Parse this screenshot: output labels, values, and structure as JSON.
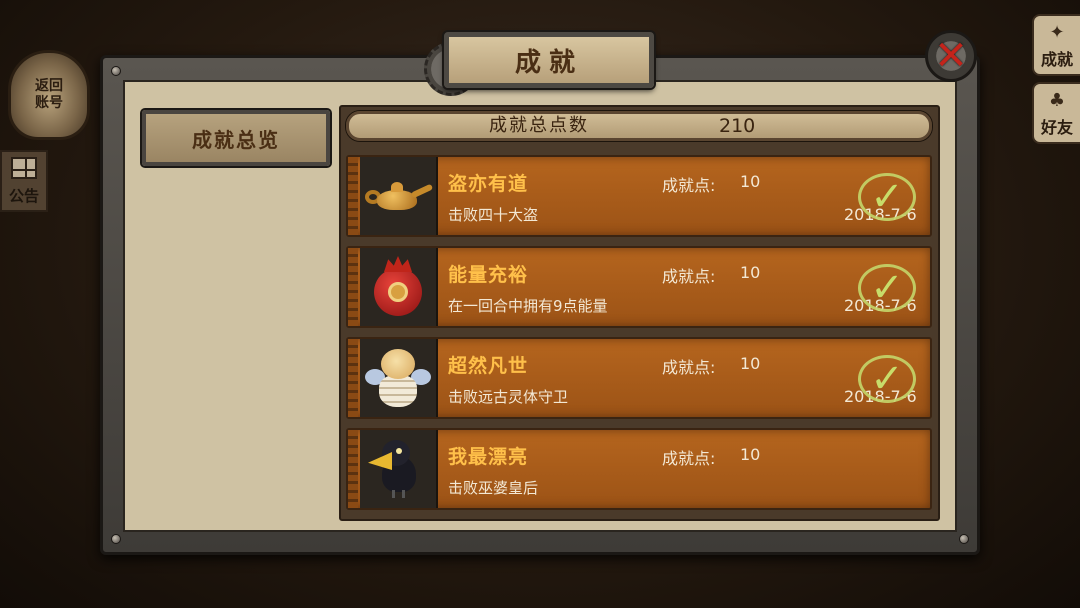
{
  "background": {
    "return_account_label": "返回账号",
    "notice_label": "公告",
    "side_tabs": [
      {
        "label": "成就",
        "icon": "achievement-icon"
      },
      {
        "label": "好友",
        "icon": "friends-icon"
      }
    ]
  },
  "dialog": {
    "title": "成就",
    "close_icon": "close-x-icon",
    "nav": {
      "overview_label": "成就总览"
    },
    "total": {
      "label": "成就总点数",
      "value": "210"
    },
    "points_label": "成就点:",
    "achievements": [
      {
        "name": "盗亦有道",
        "desc": "击败四十大盗",
        "points": "10",
        "date": "2018-7-6",
        "completed": true,
        "icon": "magic-lamp-icon"
      },
      {
        "name": "能量充裕",
        "desc": "在一回合中拥有9点能量",
        "points": "10",
        "date": "2018-7-6",
        "completed": true,
        "icon": "energy-heart-icon"
      },
      {
        "name": "超然凡世",
        "desc": "击败远古灵体守卫",
        "points": "10",
        "date": "2018-7-6",
        "completed": true,
        "icon": "winged-doll-icon"
      },
      {
        "name": "我最漂亮",
        "desc": "击败巫婆皇后",
        "points": "10",
        "date": "",
        "completed": false,
        "icon": "crow-icon"
      }
    ]
  },
  "colors": {
    "accent_orange": "#ffc04a",
    "row_brown": "#b5651e",
    "check_green": "#c8dd6a",
    "close_red": "#c4241b"
  }
}
